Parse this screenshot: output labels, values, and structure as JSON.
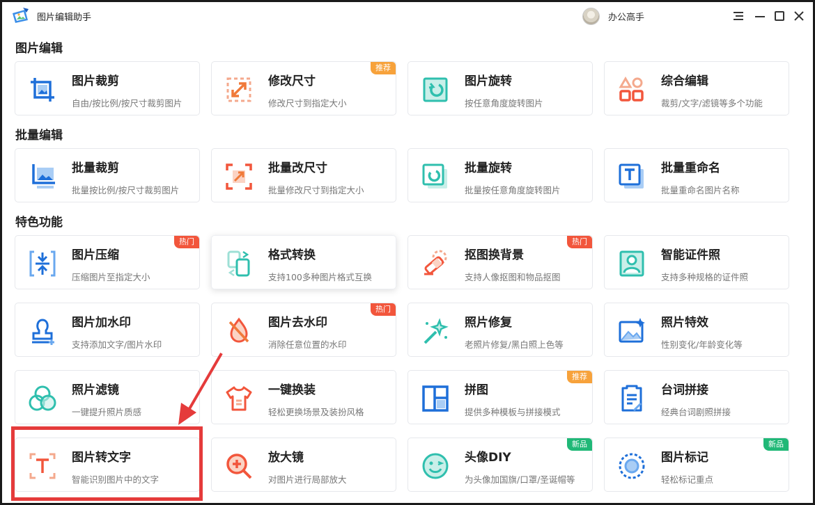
{
  "app": {
    "title": "图片编辑助手",
    "username": "办公高手"
  },
  "sections": [
    "图片编辑",
    "批量编辑",
    "特色功能"
  ],
  "cards": [
    {
      "title": "图片裁剪",
      "desc": "自由/按比例/按尺寸裁剪图片",
      "badge": ""
    },
    {
      "title": "修改尺寸",
      "desc": "修改尺寸到指定大小",
      "badge": "推荐"
    },
    {
      "title": "图片旋转",
      "desc": "按任意角度旋转图片",
      "badge": ""
    },
    {
      "title": "综合编辑",
      "desc": "裁剪/文字/滤镜等多个功能",
      "badge": ""
    },
    {
      "title": "批量裁剪",
      "desc": "批量按比例/按尺寸裁剪图片",
      "badge": ""
    },
    {
      "title": "批量改尺寸",
      "desc": "批量修改尺寸到指定大小",
      "badge": ""
    },
    {
      "title": "批量旋转",
      "desc": "批量按任意角度旋转图片",
      "badge": ""
    },
    {
      "title": "批量重命名",
      "desc": "批量重命名图片名称",
      "badge": ""
    },
    {
      "title": "图片压缩",
      "desc": "压缩图片至指定大小",
      "badge": "热门"
    },
    {
      "title": "格式转换",
      "desc": "支持100多种图片格式互换",
      "badge": ""
    },
    {
      "title": "抠图换背景",
      "desc": "支持人像抠图和物品抠图",
      "badge": "热门"
    },
    {
      "title": "智能证件照",
      "desc": "支持多种规格的证件照",
      "badge": ""
    },
    {
      "title": "图片加水印",
      "desc": "支持添加文字/图片水印",
      "badge": ""
    },
    {
      "title": "图片去水印",
      "desc": "消除任意位置的水印",
      "badge": "热门"
    },
    {
      "title": "照片修复",
      "desc": "老照片修复/黑白照上色等",
      "badge": ""
    },
    {
      "title": "照片特效",
      "desc": "性别变化/年龄变化等",
      "badge": ""
    },
    {
      "title": "照片滤镜",
      "desc": "一键提升照片质感",
      "badge": ""
    },
    {
      "title": "一键换装",
      "desc": "轻松更换场景及装扮风格",
      "badge": ""
    },
    {
      "title": "拼图",
      "desc": "提供多种模板与拼接模式",
      "badge": "推荐"
    },
    {
      "title": "台词拼接",
      "desc": "经典台词剧照拼接",
      "badge": ""
    },
    {
      "title": "图片转文字",
      "desc": "智能识别图片中的文字",
      "badge": ""
    },
    {
      "title": "放大镜",
      "desc": "对图片进行局部放大",
      "badge": ""
    },
    {
      "title": "头像DIY",
      "desc": "为头像加国旗/口罩/圣诞帽等",
      "badge": "新品"
    },
    {
      "title": "图片标记",
      "desc": "轻松标记重点",
      "badge": "新品"
    }
  ],
  "colors": {
    "accent_blue": "#1e6fd9",
    "accent_orange": "#f07a3a",
    "accent_teal": "#2fbfae",
    "highlight_red": "#e53b3b"
  }
}
